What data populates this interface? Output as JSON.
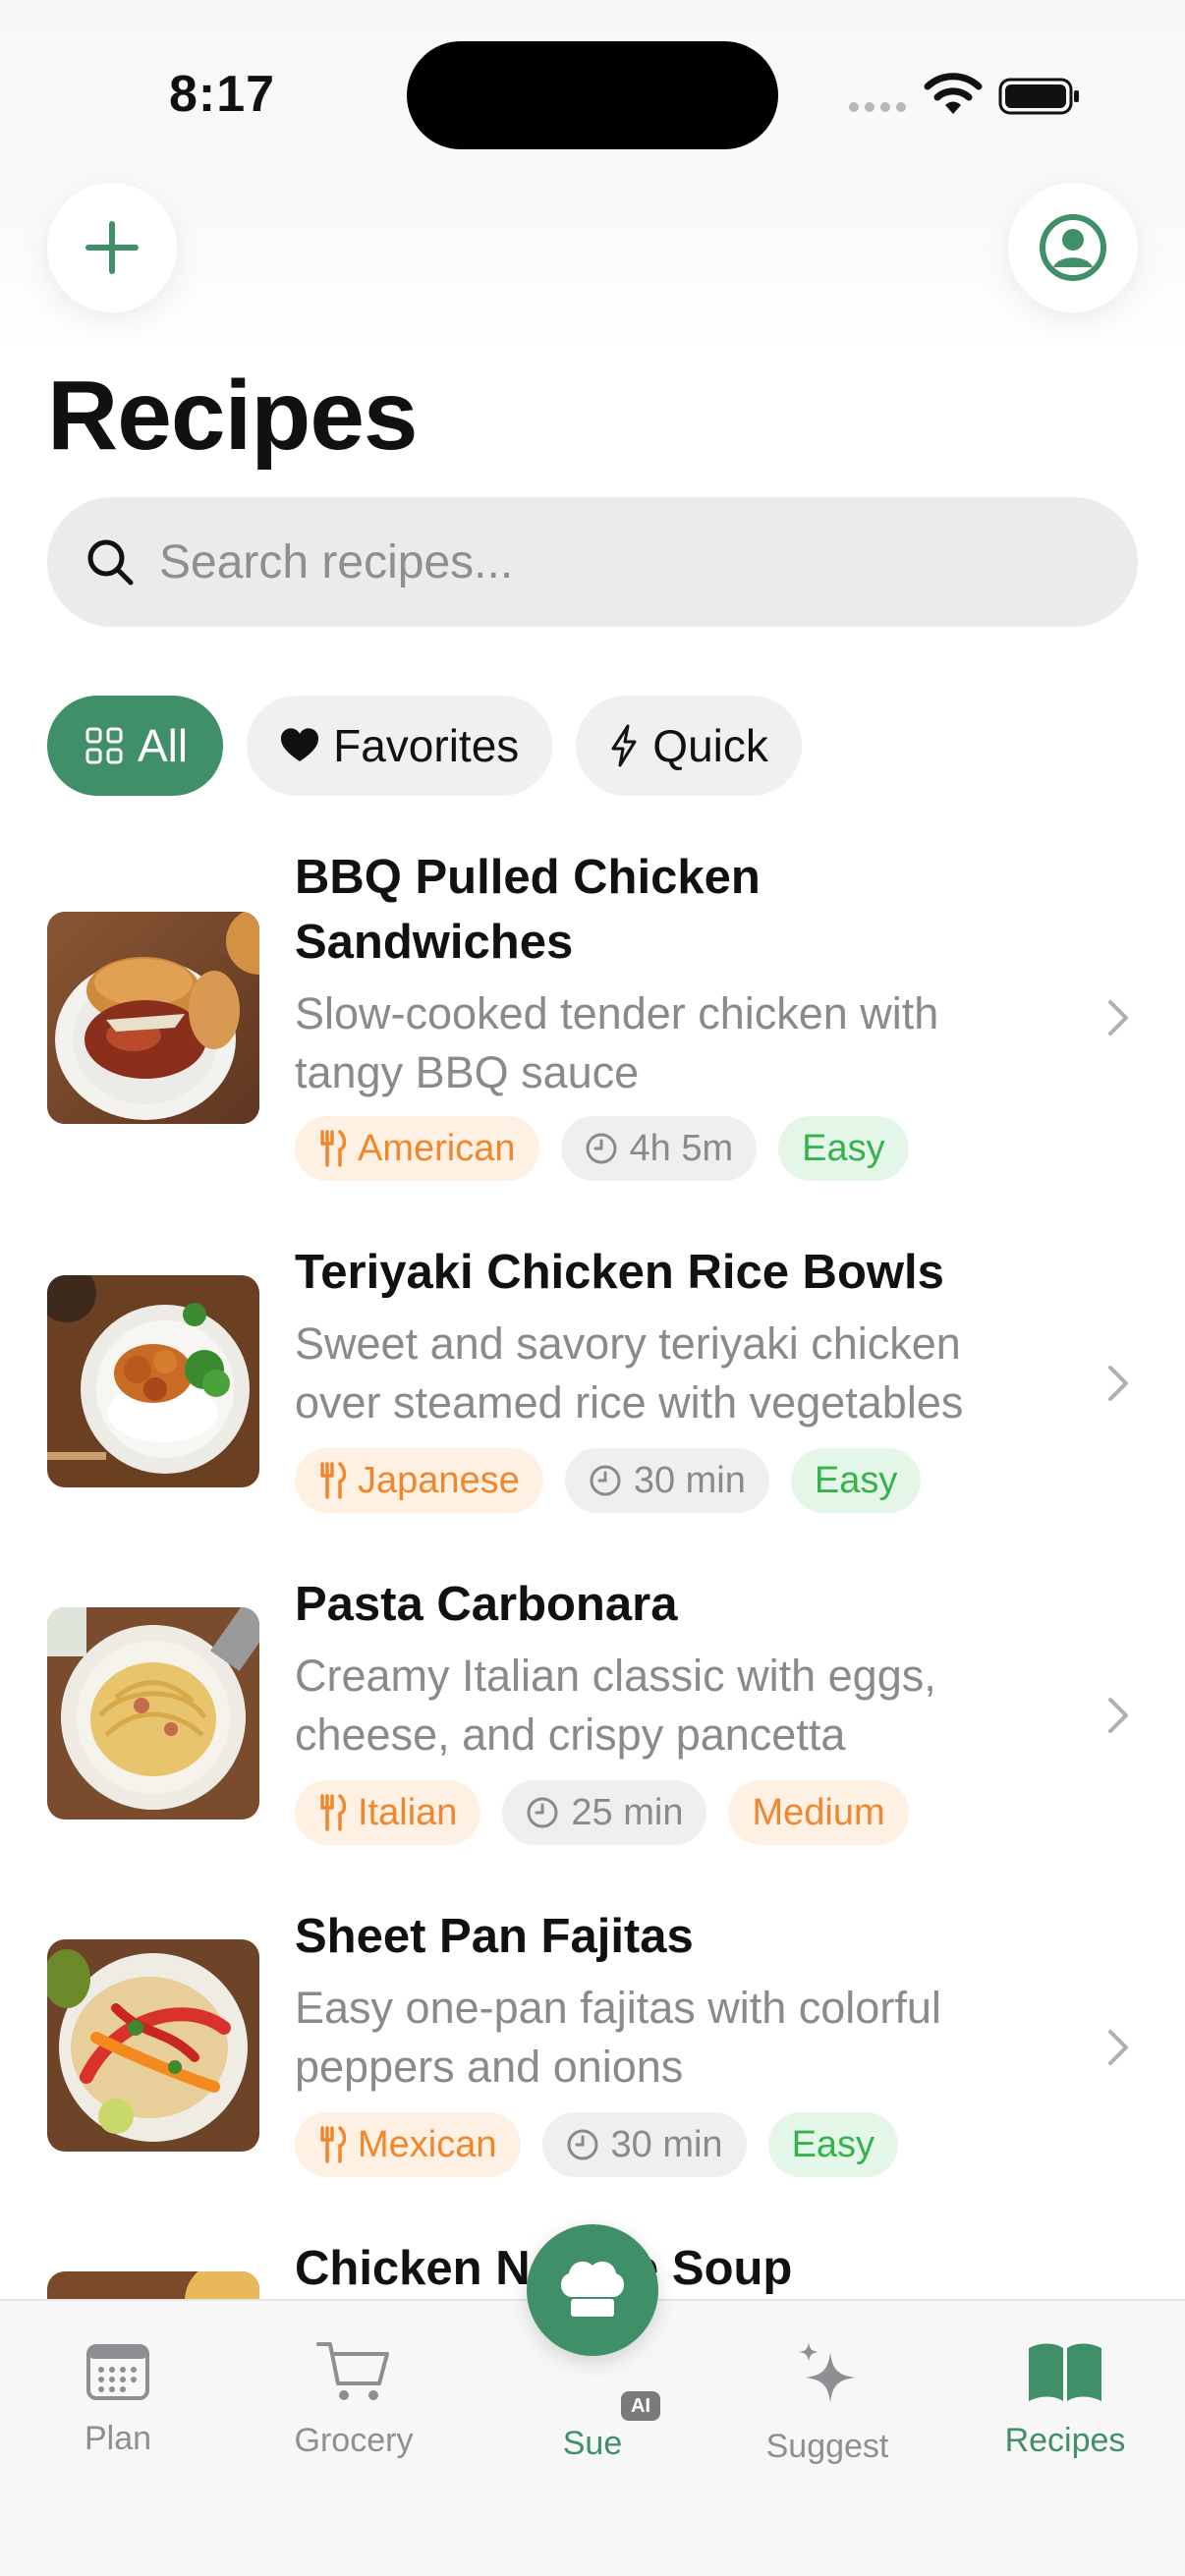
{
  "status_bar": {
    "time": "8:17"
  },
  "header": {
    "title": "Recipes"
  },
  "search": {
    "placeholder": "Search recipes..."
  },
  "filters": [
    {
      "label": "All",
      "icon": "grid-icon",
      "active": true
    },
    {
      "label": "Favorites",
      "icon": "heart-icon",
      "active": false
    },
    {
      "label": "Quick",
      "icon": "bolt-icon",
      "active": false
    }
  ],
  "recipes": [
    {
      "title_line1": "BBQ Pulled Chicken",
      "title_line2": "Sandwiches",
      "desc_line1": "Slow-cooked tender chicken with",
      "desc_line2": "tangy BBQ sauce",
      "cuisine": "American",
      "time": "4h 5m",
      "difficulty": "Easy"
    },
    {
      "title_line1": "Teriyaki Chicken Rice Bowls",
      "desc_line1": "Sweet and savory teriyaki chicken",
      "desc_line2": "over steamed rice with vegetables",
      "cuisine": "Japanese",
      "time": "30 min",
      "difficulty": "Easy"
    },
    {
      "title_line1": "Pasta Carbonara",
      "desc_line1": "Creamy Italian classic with eggs,",
      "desc_line2": "cheese, and crispy pancetta",
      "cuisine": "Italian",
      "time": "25 min",
      "difficulty": "Medium"
    },
    {
      "title_line1": "Sheet Pan Fajitas",
      "desc_line1": "Easy one-pan fajitas with colorful",
      "desc_line2": "peppers and onions",
      "cuisine": "Mexican",
      "time": "30 min",
      "difficulty": "Easy"
    },
    {
      "title_line1": "Chicken Noodle Soup"
    }
  ],
  "tabbar": {
    "plan": "Plan",
    "grocery": "Grocery",
    "sue": "Sue",
    "ai_badge": "AI",
    "suggest": "Suggest",
    "recipes": "Recipes"
  },
  "colors": {
    "accent": "#3f8f68",
    "orange": "#f1872d",
    "green": "#36b24f",
    "gray": "#8a8a8e"
  }
}
